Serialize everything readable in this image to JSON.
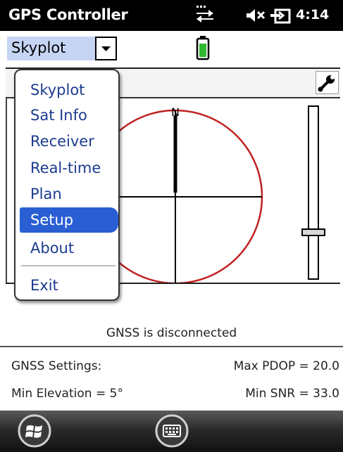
{
  "status_bar": {
    "title": "GPS Controller",
    "time": "4:14",
    "icons": [
      "data-connection-icon",
      "volume-muted-icon",
      "power-plug-icon",
      "battery-icon"
    ]
  },
  "toolbar": {
    "view_selector_value": "Skyplot",
    "settings_icon": "wrench-icon"
  },
  "menu": {
    "items": [
      {
        "label": "Skyplot"
      },
      {
        "label": "Sat Info"
      },
      {
        "label": "Receiver"
      },
      {
        "label": "Real-time"
      },
      {
        "label": "Plan"
      },
      {
        "label": "Setup"
      },
      {
        "label": "About"
      },
      {
        "label": "Exit"
      }
    ],
    "selected": "Setup"
  },
  "skyplot": {
    "north_label": "N",
    "ring_color": "#c02020"
  },
  "info": {
    "status": "GNSS is disconnected",
    "gnss_settings_label": "GNSS Settings:",
    "max_pdop": "Max PDOP = 20.0",
    "min_elevation": "Min Elevation = 5°",
    "min_snr": "Min SNR = 33.0"
  },
  "taskbar": {
    "icons": [
      "windows-start-icon",
      "keyboard-icon"
    ]
  },
  "colors": {
    "accent": "#2a5fd4",
    "menu_text": "#1d3c8f",
    "selector_bg": "#c7d5f5",
    "battery_fill": "#2db82d"
  }
}
